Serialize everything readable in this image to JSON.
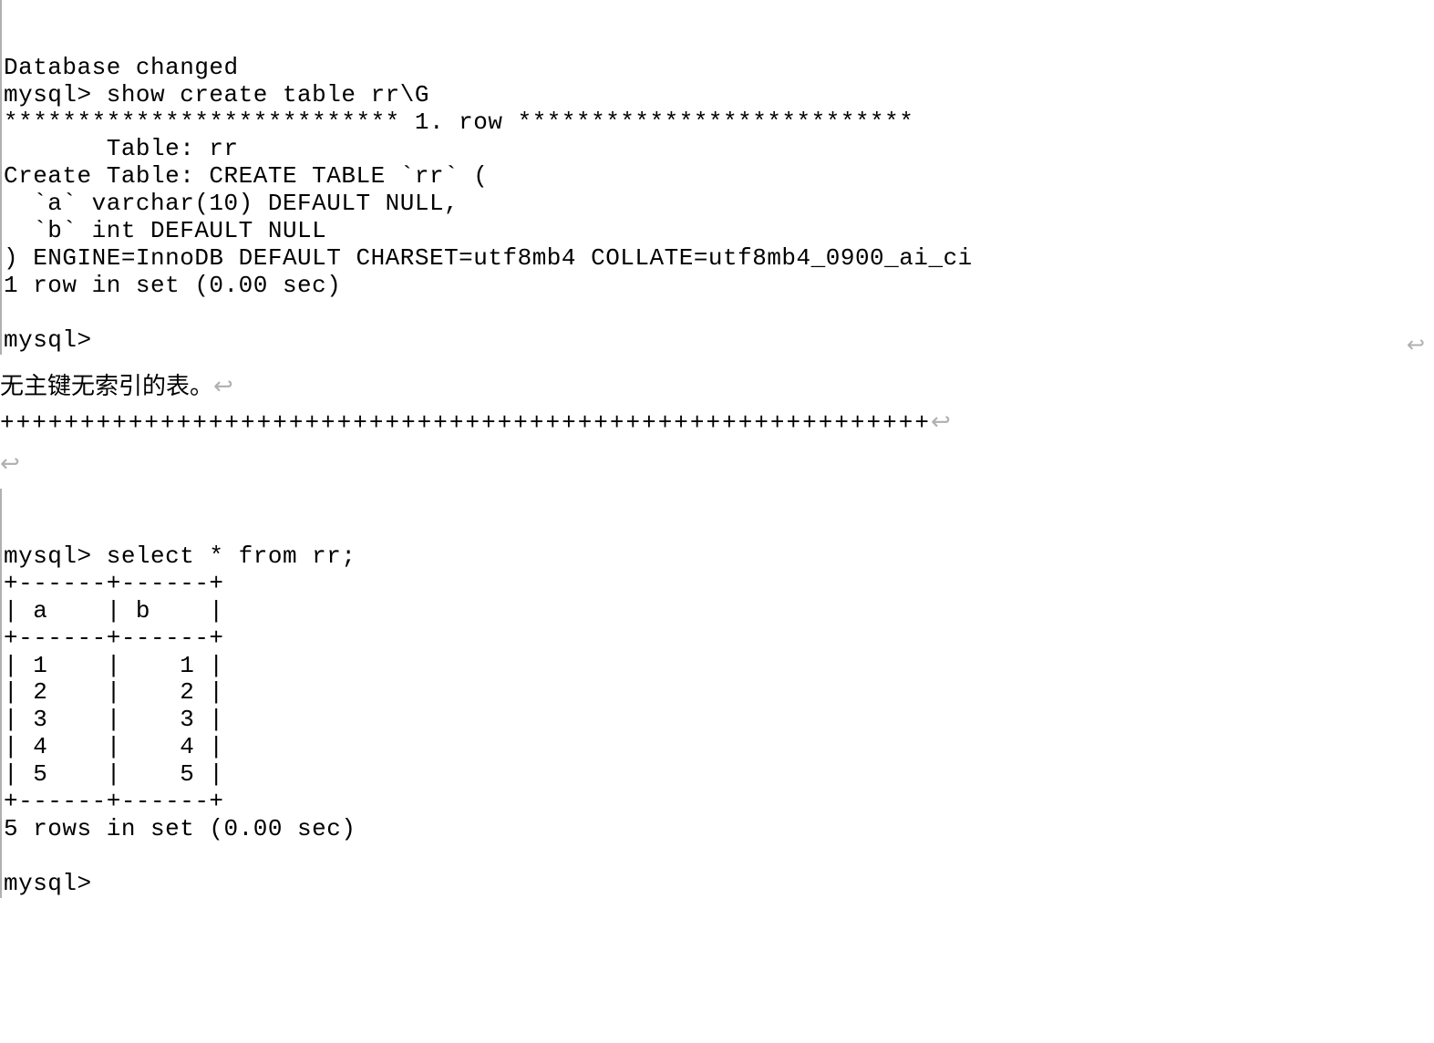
{
  "block1": {
    "line1": "",
    "line2": "Database changed",
    "line3": "mysql> show create table rr\\G",
    "line4": "*************************** 1. row ***************************",
    "line5": "       Table: rr",
    "line6": "Create Table: CREATE TABLE `rr` (",
    "line7": "  `a` varchar(10) DEFAULT NULL,",
    "line8": "  `b` int DEFAULT NULL",
    "line9": ") ENGINE=InnoDB DEFAULT CHARSET=utf8mb4 COLLATE=utf8mb4_0900_ai_ci",
    "line10": "1 row in set (0.00 sec)",
    "line11": "",
    "line12": "mysql>"
  },
  "caption_text": "无主键无索引的表。",
  "pilcrow_char": "↩",
  "plus_row": "++++++++++++++++++++++++++++++++++++++++++++++++++++++++++",
  "block2": {
    "line1": "",
    "line2": "mysql> select * from rr;",
    "line3": "+------+------+",
    "line4": "| a    | b    |",
    "line5": "+------+------+",
    "line6": "| 1    |    1 |",
    "line7": "| 2    |    2 |",
    "line8": "| 3    |    3 |",
    "line9": "| 4    |    4 |",
    "line10": "| 5    |    5 |",
    "line11": "+------+------+",
    "line12": "5 rows in set (0.00 sec)",
    "line13": "",
    "line14": "mysql>"
  }
}
